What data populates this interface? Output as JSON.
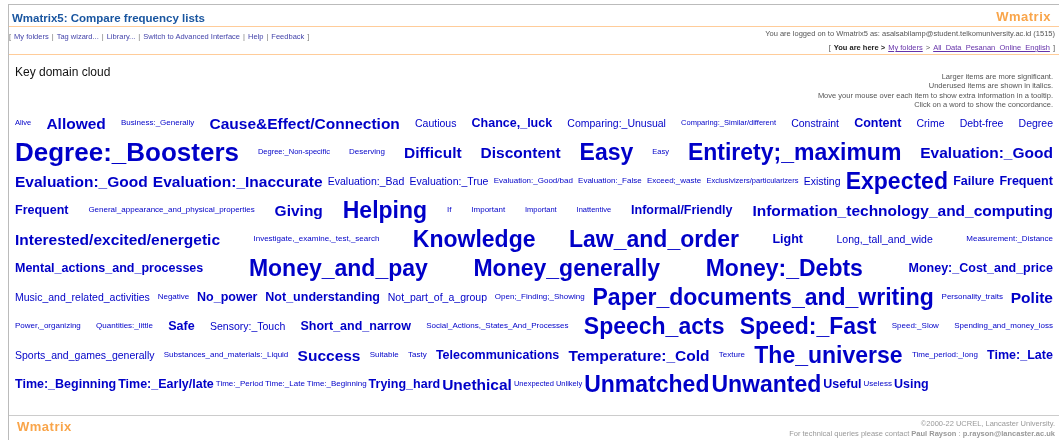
{
  "header": {
    "title": "Wmatrix5: Compare frequency lists",
    "logo": "Wmatrix",
    "nav": {
      "open": "[",
      "separator": "|",
      "close": "]",
      "links": [
        "My folders",
        "Tag wizard...",
        "Library...",
        "Switch to Advanced Interface",
        "Help",
        "Feedback"
      ]
    },
    "login": "You are logged on to Wmatrix5 as: asalsabilamp@student.telkomuniversity.ac.id (1515)",
    "breadcrumb": {
      "open": "[",
      "separator": ">",
      "close": "]",
      "label": "You are here >",
      "links": [
        "My folders",
        "All_Data_Pesanan_Online_English"
      ]
    }
  },
  "heading": "Key domain cloud",
  "notes": [
    "Larger items are more significant.",
    "Underused items are shown in italics.",
    "Move your mouse over each item to show extra information in a tooltip.",
    "Click on a word to show the concordance."
  ],
  "cloud": {
    "rows": [
      {
        "justified": true,
        "words": [
          {
            "text": "Alive",
            "kind": "xs"
          },
          {
            "text": "Allowed",
            "kind": "l"
          },
          {
            "text": "Business:_Generally",
            "kind": "s"
          },
          {
            "text": "Cause&Effect/Connection",
            "kind": "l"
          },
          {
            "text": "Cautious",
            "kind": "m"
          },
          {
            "text": "Chance,_luck",
            "kind": "ml"
          },
          {
            "text": "Comparing:_Unusual",
            "kind": "m"
          },
          {
            "text": "Comparing:_Similar/different",
            "kind": "xs"
          },
          {
            "text": "Constraint",
            "kind": "m"
          },
          {
            "text": "Content",
            "kind": "ml"
          },
          {
            "text": "Crime",
            "kind": "m"
          },
          {
            "text": "Debt-free",
            "kind": "m"
          },
          {
            "text": "Degree",
            "kind": "m"
          }
        ]
      },
      {
        "justified": true,
        "words": [
          {
            "text": "Degree:_Boosters",
            "kind": "xxl"
          },
          {
            "text": "Degree:_Non-specific",
            "kind": "xs"
          },
          {
            "text": "Deserving",
            "kind": "s"
          },
          {
            "text": "Difficult",
            "kind": "l"
          },
          {
            "text": "Discontent",
            "kind": "l"
          },
          {
            "text": "Easy",
            "kind": "xl"
          },
          {
            "text": "Easy",
            "kind": "xs"
          },
          {
            "text": "Entirety;_maximum",
            "kind": "xl"
          },
          {
            "text": "Evaluation:_Good",
            "kind": "l"
          }
        ]
      },
      {
        "justified": true,
        "words": [
          {
            "text": "Evaluation:_Good",
            "kind": "l"
          },
          {
            "text": "Evaluation:_Inaccurate",
            "kind": "l"
          },
          {
            "text": "Evaluation:_Bad",
            "kind": "m"
          },
          {
            "text": "Evaluation:_True",
            "kind": "m"
          },
          {
            "text": "Evaluation:_Good/bad",
            "kind": "s"
          },
          {
            "text": "Evaluation:_False",
            "kind": "s"
          },
          {
            "text": "Exceed;_waste",
            "kind": "s"
          },
          {
            "text": "Exclusivizers/particularizers",
            "kind": "xs"
          },
          {
            "text": "Existing",
            "kind": "m"
          },
          {
            "text": "Expected",
            "kind": "xl"
          },
          {
            "text": "Failure",
            "kind": "ml"
          },
          {
            "text": "Frequent",
            "kind": "ml"
          }
        ]
      },
      {
        "justified": true,
        "words": [
          {
            "text": "Frequent",
            "kind": "ml"
          },
          {
            "text": "General_appearance_and_physical_properties",
            "kind": "s"
          },
          {
            "text": "Giving",
            "kind": "l"
          },
          {
            "text": "Helping",
            "kind": "xl"
          },
          {
            "text": "If",
            "kind": "s"
          },
          {
            "text": "Important",
            "kind": "s"
          },
          {
            "text": "Important",
            "kind": "xs"
          },
          {
            "text": "Inattentive",
            "kind": "xs"
          },
          {
            "text": "Informal/Friendly",
            "kind": "ml"
          },
          {
            "text": "Information_technology_and_computing",
            "kind": "l"
          }
        ]
      },
      {
        "justified": true,
        "words": [
          {
            "text": "Interested/excited/energetic",
            "kind": "l"
          },
          {
            "text": "Investigate,_examine,_test,_search",
            "kind": "s"
          },
          {
            "text": "Knowledge",
            "kind": "xl"
          },
          {
            "text": "Law_and_order",
            "kind": "xl"
          },
          {
            "text": "Light",
            "kind": "ml"
          },
          {
            "text": "Long,_tall_and_wide",
            "kind": "m"
          },
          {
            "text": "Measurement:_Distance",
            "kind": "s"
          }
        ]
      },
      {
        "justified": true,
        "words": [
          {
            "text": "Mental_actions_and_processes",
            "kind": "ml"
          },
          {
            "text": "Money_and_pay",
            "kind": "xl"
          },
          {
            "text": "Money_generally",
            "kind": "xl"
          },
          {
            "text": "Money:_Debts",
            "kind": "xl"
          },
          {
            "text": "Money:_Cost_and_price",
            "kind": "ml"
          }
        ]
      },
      {
        "justified": true,
        "words": [
          {
            "text": "Music_and_related_activities",
            "kind": "m"
          },
          {
            "text": "Negative",
            "kind": "s"
          },
          {
            "text": "No_power",
            "kind": "ml"
          },
          {
            "text": "Not_understanding",
            "kind": "ml"
          },
          {
            "text": "Not_part_of_a_group",
            "kind": "m"
          },
          {
            "text": "Open;_Finding;_Showing",
            "kind": "s"
          },
          {
            "text": "Paper_documents_and_writing",
            "kind": "xl"
          },
          {
            "text": "Personality_traits",
            "kind": "s"
          },
          {
            "text": "Polite",
            "kind": "l"
          }
        ]
      },
      {
        "justified": true,
        "words": [
          {
            "text": "Power,_organizing",
            "kind": "s"
          },
          {
            "text": "Quantities:_little",
            "kind": "s"
          },
          {
            "text": "Safe",
            "kind": "ml"
          },
          {
            "text": "Sensory:_Touch",
            "kind": "m"
          },
          {
            "text": "Short_and_narrow",
            "kind": "ml"
          },
          {
            "text": "Social_Actions,_States_And_Processes",
            "kind": "s"
          },
          {
            "text": "Speech_acts",
            "kind": "xl"
          },
          {
            "text": "Speed:_Fast",
            "kind": "xl"
          },
          {
            "text": "Speed:_Slow",
            "kind": "s"
          },
          {
            "text": "Spending_and_money_loss",
            "kind": "s"
          }
        ]
      },
      {
        "justified": true,
        "words": [
          {
            "text": "Sports_and_games_generally",
            "kind": "m"
          },
          {
            "text": "Substances_and_materials:_Liquid",
            "kind": "s"
          },
          {
            "text": "Success",
            "kind": "l"
          },
          {
            "text": "Suitable",
            "kind": "s"
          },
          {
            "text": "Tasty",
            "kind": "s"
          },
          {
            "text": "Telecommunications",
            "kind": "ml"
          },
          {
            "text": "Temperature:_Cold",
            "kind": "l"
          },
          {
            "text": "Texture",
            "kind": "s"
          },
          {
            "text": "The_universe",
            "kind": "xl"
          },
          {
            "text": "Time_period:_long",
            "kind": "s"
          },
          {
            "text": "Time:_Late",
            "kind": "ml"
          }
        ]
      },
      {
        "justified": false,
        "words": [
          {
            "text": "Time:_Beginning",
            "kind": "ml"
          },
          {
            "text": "Time:_Early/late",
            "kind": "ml"
          },
          {
            "text": "Time:_Period",
            "kind": "s"
          },
          {
            "text": "Time:_Late",
            "kind": "s"
          },
          {
            "text": "Time:_Beginning",
            "kind": "s"
          },
          {
            "text": "Trying_hard",
            "kind": "ml"
          },
          {
            "text": "Unethical",
            "kind": "l"
          },
          {
            "text": "Unexpected",
            "kind": "xs"
          },
          {
            "text": "Unlikely",
            "kind": "xs"
          },
          {
            "text": "Unmatched",
            "kind": "xl"
          },
          {
            "text": "Unwanted",
            "kind": "xl"
          },
          {
            "text": "Useful",
            "kind": "ml"
          },
          {
            "text": "Useless",
            "kind": "s"
          },
          {
            "text": "Using",
            "kind": "ml"
          }
        ]
      }
    ]
  },
  "footer": {
    "logo": "Wmatrix",
    "copyright": "©2000-22 UCREL, Lancaster University.",
    "contact": "For technical queries please contact **Paul Rayson** : **p.rayson@lancaster.ac.uk**"
  }
}
